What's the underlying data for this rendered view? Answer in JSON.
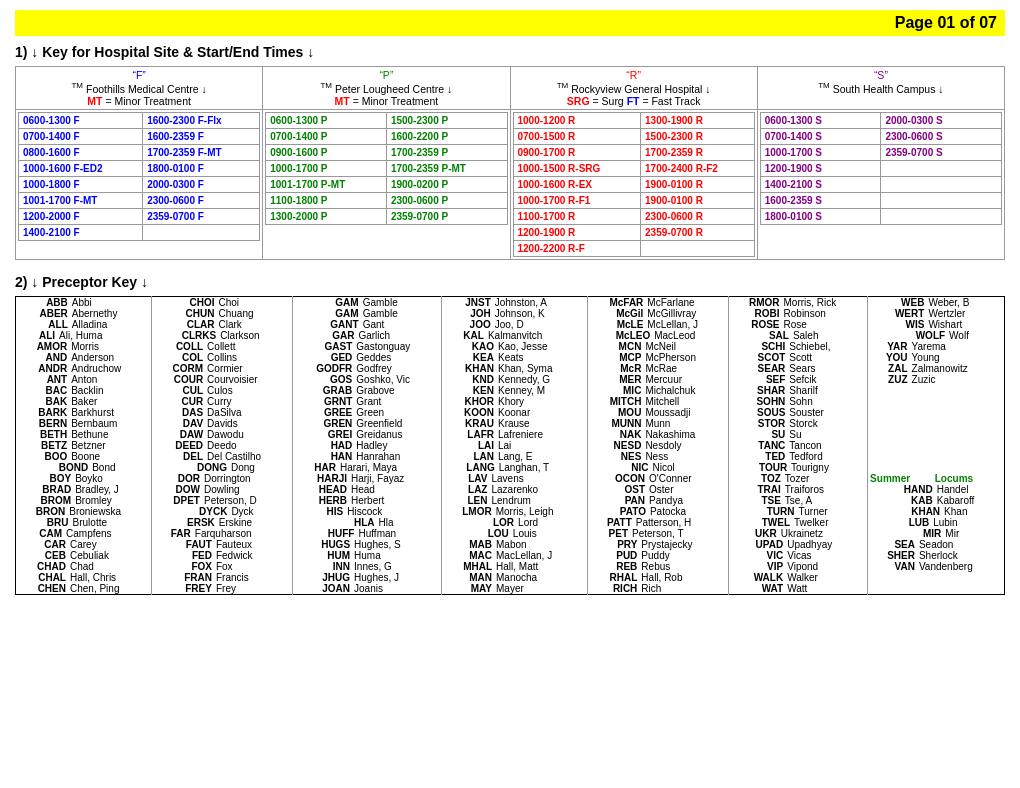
{
  "header": {
    "page": "Page 01 of 07"
  },
  "section1": {
    "title": "1)  ↓ Key for Hospital Site & Start/End Times ↓"
  },
  "hospitals": [
    {
      "label": "\"F\"",
      "color": "blue",
      "name": "Foothills Medical Centre ↓",
      "mt": "MT = Minor Treatment",
      "times": [
        [
          "0600-1300 F",
          "1600-2300 F-Flx"
        ],
        [
          "0700-1400 F",
          "1600-2359 F"
        ],
        [
          "0800-1600 F",
          "1700-2359 F-MT"
        ],
        [
          "1000-1600 F-ED2",
          "1800-0100 F"
        ],
        [
          "1000-1800 F",
          "2000-0300 F"
        ],
        [
          "1001-1700 F-MT",
          "2300-0600 F"
        ],
        [
          "1200-2000 F",
          "2359-0700 F"
        ],
        [
          "1400-2100 F",
          ""
        ]
      ]
    },
    {
      "label": "\"P\"",
      "color": "green",
      "name": "Peter Lougheed Centre ↓",
      "mt": "MT = Minor Treatment",
      "times": [
        [
          "0600-1300 P",
          "1500-2300 P"
        ],
        [
          "0700-1400 P",
          "1600-2200 P"
        ],
        [
          "0900-1600 P",
          "1700-2359 P"
        ],
        [
          "1000-1700 P",
          "1700-2359 P-MT"
        ],
        [
          "1001-1700 P-MT",
          "1900-0200 P"
        ],
        [
          "1100-1800 P",
          "2300-0600 P"
        ],
        [
          "1300-2000 P",
          "2359-0700 P"
        ]
      ]
    },
    {
      "label": "\"R\"",
      "color": "red",
      "name": "Rockyview General Hospital ↓",
      "mt": "SRG = Surg  FT = Fast Track",
      "times": [
        [
          "1000-1200 R",
          "1300-1900 R"
        ],
        [
          "0700-1500 R",
          "1500-2300 R"
        ],
        [
          "0900-1700 R",
          "1700-2359 R"
        ],
        [
          "1000-1500 R-SRG",
          "1700-2400 R-F2"
        ],
        [
          "1000-1600 R-EX",
          "1900-0100 R"
        ],
        [
          "1000-1700 R-F1",
          "1900-0100 R"
        ],
        [
          "1100-1700 R",
          "2300-0600 R"
        ],
        [
          "1200-1900 R",
          "2359-0700 R"
        ],
        [
          "1200-2200 R-F",
          ""
        ]
      ]
    },
    {
      "label": "\"S\"",
      "color": "purple",
      "name": "South Health Campus ↓",
      "times": [
        [
          "0600-1300 S",
          "2000-0300 S"
        ],
        [
          "0700-1400 S",
          "2300-0600 S"
        ],
        [
          "1000-1700 S",
          "2359-0700 S"
        ],
        [
          "1200-1900 S",
          ""
        ],
        [
          "1400-2100 S",
          ""
        ],
        [
          "1600-2359 S",
          ""
        ],
        [
          "1800-0100 S",
          ""
        ]
      ]
    }
  ],
  "section2": {
    "title": "2)  ↓ Preceptor Key ↓"
  },
  "preceptors": [
    {
      "code": "ABB",
      "name": "Abbi"
    },
    {
      "code": "ABER",
      "name": "Abernethy"
    },
    {
      "code": "ALL",
      "name": "Alladina"
    },
    {
      "code": "ALI",
      "name": "Ali, Huma"
    },
    {
      "code": "AMOR",
      "name": "Morris"
    },
    {
      "code": "AND",
      "name": "Anderson"
    },
    {
      "code": "ANDR",
      "name": "Andruchow"
    },
    {
      "code": "ANT",
      "name": "Anton"
    },
    {
      "code": "BAC",
      "name": "Backlin"
    },
    {
      "code": "BAK",
      "name": "Baker"
    },
    {
      "code": "BARK",
      "name": "Barkhurst"
    },
    {
      "code": "BERN",
      "name": "Bernbaum"
    },
    {
      "code": "BETH",
      "name": "Bethune"
    },
    {
      "code": "BETZ",
      "name": "Betzner"
    },
    {
      "code": "BOO",
      "name": "Boone"
    },
    {
      "code": "BOND",
      "name": "Bond"
    },
    {
      "code": "BOY",
      "name": "Boyko"
    },
    {
      "code": "BRAD",
      "name": "Bradley, J"
    },
    {
      "code": "BROM",
      "name": "Bromley"
    },
    {
      "code": "BRON",
      "name": "Broniewska"
    },
    {
      "code": "BRU",
      "name": "Brulotte"
    },
    {
      "code": "CAM",
      "name": "Campfens"
    },
    {
      "code": "CAR",
      "name": "Carey"
    },
    {
      "code": "CEB",
      "name": "Cebuliak"
    },
    {
      "code": "CHAD",
      "name": "Chad"
    },
    {
      "code": "CHAL",
      "name": "Hall, Chris"
    },
    {
      "code": "CHEN",
      "name": "Chen, Ping"
    },
    {
      "code": "CHOI",
      "name": "Choi"
    },
    {
      "code": "CHUN",
      "name": "Chuang"
    },
    {
      "code": "CLAR",
      "name": "Clark"
    },
    {
      "code": "CLRKS",
      "name": "Clarkson"
    },
    {
      "code": "COLL",
      "name": "Collett"
    },
    {
      "code": "COL",
      "name": "Collins"
    },
    {
      "code": "CORM",
      "name": "Cormier"
    },
    {
      "code": "COUR",
      "name": "Courvoisier"
    },
    {
      "code": "CUL",
      "name": "Culos"
    },
    {
      "code": "CUR",
      "name": "Curry"
    },
    {
      "code": "DAS",
      "name": "DaSilva"
    },
    {
      "code": "DAV",
      "name": "Davids"
    },
    {
      "code": "DAW",
      "name": "Dawodu"
    },
    {
      "code": "DEED",
      "name": "Deedo"
    },
    {
      "code": "DEL",
      "name": "Del Castilho"
    },
    {
      "code": "DONG",
      "name": "Dong"
    },
    {
      "code": "DOR",
      "name": "Dorrington"
    },
    {
      "code": "DOW",
      "name": "Dowling"
    },
    {
      "code": "DPET",
      "name": "Peterson, D"
    },
    {
      "code": "DYCK",
      "name": "Dyck"
    },
    {
      "code": "ERSK",
      "name": "Erskine"
    },
    {
      "code": "FAR",
      "name": "Farquharson"
    },
    {
      "code": "FAUT",
      "name": "Fauteux"
    },
    {
      "code": "FED",
      "name": "Fedwick"
    },
    {
      "code": "FOX",
      "name": "Fox"
    },
    {
      "code": "FRAN",
      "name": "Francis"
    },
    {
      "code": "FREY",
      "name": "Frey"
    },
    {
      "code": "GAM",
      "name": "Gamble"
    },
    {
      "code": "GAM",
      "name": "Gamble"
    },
    {
      "code": "GANT",
      "name": "Gant"
    },
    {
      "code": "GAR",
      "name": "Garlich"
    },
    {
      "code": "GAST",
      "name": "Gastonguay"
    },
    {
      "code": "GED",
      "name": "Geddes"
    },
    {
      "code": "GODFR",
      "name": "Godfrey"
    },
    {
      "code": "GOS",
      "name": "Goshko, Vic"
    },
    {
      "code": "GRAB",
      "name": "Grabove"
    },
    {
      "code": "GRNT",
      "name": "Grant"
    },
    {
      "code": "GREE",
      "name": "Green"
    },
    {
      "code": "GREN",
      "name": "Greenfield"
    },
    {
      "code": "GREI",
      "name": "Greidanus"
    },
    {
      "code": "HAD",
      "name": "Hadley"
    },
    {
      "code": "HAN",
      "name": "Hanrahan"
    },
    {
      "code": "HAR",
      "name": "Harari, Maya"
    },
    {
      "code": "HARJI",
      "name": "Harji, Fayaz"
    },
    {
      "code": "HEAD",
      "name": "Head"
    },
    {
      "code": "HERB",
      "name": "Herbert"
    },
    {
      "code": "HIS",
      "name": "Hiscock"
    },
    {
      "code": "HLA",
      "name": "Hla"
    },
    {
      "code": "HUFF",
      "name": "Huffman"
    },
    {
      "code": "HUGS",
      "name": "Hughes, S"
    },
    {
      "code": "HUM",
      "name": "Huma"
    },
    {
      "code": "INN",
      "name": "Innes, G"
    },
    {
      "code": "JHUG",
      "name": "Hughes, J"
    },
    {
      "code": "JOAN",
      "name": "Joanis"
    },
    {
      "code": "JNST",
      "name": "Johnston, A"
    },
    {
      "code": "JOH",
      "name": "Johnson, K"
    },
    {
      "code": "JOO",
      "name": "Joo, D"
    },
    {
      "code": "KAL",
      "name": "Kalmanvitch"
    },
    {
      "code": "KAO",
      "name": "Kao, Jesse"
    },
    {
      "code": "KEA",
      "name": "Keats"
    },
    {
      "code": "KHAN",
      "name": "Khan, Syma"
    },
    {
      "code": "KND",
      "name": "Kennedy, G"
    },
    {
      "code": "KEN",
      "name": "Kenney, M"
    },
    {
      "code": "KHOR",
      "name": "Khory"
    },
    {
      "code": "KOON",
      "name": "Koonar"
    },
    {
      "code": "KRAU",
      "name": "Krause"
    },
    {
      "code": "LAFR",
      "name": "Lafreniere"
    },
    {
      "code": "LAI",
      "name": "Lai"
    },
    {
      "code": "LAN",
      "name": "Lang, E"
    },
    {
      "code": "LANG",
      "name": "Langhan, T"
    },
    {
      "code": "LAV",
      "name": "Lavens"
    },
    {
      "code": "LAZ",
      "name": "Lazarenko"
    },
    {
      "code": "LEN",
      "name": "Lendrum"
    },
    {
      "code": "LMOR",
      "name": "Morris, Leigh"
    },
    {
      "code": "LOR",
      "name": "Lord"
    },
    {
      "code": "LOU",
      "name": "Louis"
    },
    {
      "code": "MAB",
      "name": "Mabon"
    },
    {
      "code": "MAC",
      "name": "MacLellan, J"
    },
    {
      "code": "MHAL",
      "name": "Hall, Matt"
    },
    {
      "code": "MAN",
      "name": "Manocha"
    },
    {
      "code": "MAY",
      "name": "Mayer"
    },
    {
      "code": "McFAR",
      "name": "McFarlane"
    },
    {
      "code": "McGil",
      "name": "McGillivray"
    },
    {
      "code": "McLE",
      "name": "McLellan, J"
    },
    {
      "code": "McLEO",
      "name": "MacLeod"
    },
    {
      "code": "MCN",
      "name": "McNeil"
    },
    {
      "code": "MCP",
      "name": "McPherson"
    },
    {
      "code": "McR",
      "name": "McRae"
    },
    {
      "code": "MER",
      "name": "Mercuur"
    },
    {
      "code": "MIC",
      "name": "Michalchuk"
    },
    {
      "code": "MITCH",
      "name": "Mitchell"
    },
    {
      "code": "MOU",
      "name": "Moussadji"
    },
    {
      "code": "MUNN",
      "name": "Munn"
    },
    {
      "code": "NAK",
      "name": "Nakashima"
    },
    {
      "code": "NESD",
      "name": "Nesdoly"
    },
    {
      "code": "NES",
      "name": "Ness"
    },
    {
      "code": "NIC",
      "name": "Nicol"
    },
    {
      "code": "OCON",
      "name": "O'Conner"
    },
    {
      "code": "OST",
      "name": "Oster"
    },
    {
      "code": "PAN",
      "name": "Pandya"
    },
    {
      "code": "PATO",
      "name": "Patocka"
    },
    {
      "code": "PATT",
      "name": "Patterson, H"
    },
    {
      "code": "PET",
      "name": "Peterson, T"
    },
    {
      "code": "PRY",
      "name": "Prystajecky"
    },
    {
      "code": "PUD",
      "name": "Puddy"
    },
    {
      "code": "REB",
      "name": "Rebus"
    },
    {
      "code": "RHAL",
      "name": "Hall, Rob"
    },
    {
      "code": "RICH",
      "name": "Rich"
    },
    {
      "code": "RMOR",
      "name": "Morris, Rick"
    },
    {
      "code": "ROBI",
      "name": "Robinson"
    },
    {
      "code": "ROSE",
      "name": "Rose"
    },
    {
      "code": "SAL",
      "name": "Saleh"
    },
    {
      "code": "SCHI",
      "name": "Schiebel,"
    },
    {
      "code": "SCOT",
      "name": "Scott"
    },
    {
      "code": "SEAR",
      "name": "Sears"
    },
    {
      "code": "SEF",
      "name": "Sefcik"
    },
    {
      "code": "SHAR",
      "name": "Sharilf"
    },
    {
      "code": "SOHN",
      "name": "Sohn"
    },
    {
      "code": "SOUS",
      "name": "Souster"
    },
    {
      "code": "STOR",
      "name": "Storck"
    },
    {
      "code": "SU",
      "name": "Su"
    },
    {
      "code": "TANC",
      "name": "Tancon"
    },
    {
      "code": "TED",
      "name": "Tedford"
    },
    {
      "code": "TOUR",
      "name": "Tourigny"
    },
    {
      "code": "TOZ",
      "name": "Tozer"
    },
    {
      "code": "TRAI",
      "name": "Traiforos"
    },
    {
      "code": "TSE",
      "name": "Tse, A"
    },
    {
      "code": "TURN",
      "name": "Turner"
    },
    {
      "code": "TWEL",
      "name": "Twelker"
    },
    {
      "code": "UKR",
      "name": "Ukrainetz"
    },
    {
      "code": "UPAD",
      "name": "Upadhyay"
    },
    {
      "code": "VIC",
      "name": "Vicas"
    },
    {
      "code": "VIP",
      "name": "Vipond"
    },
    {
      "code": "WALK",
      "name": "Walker"
    },
    {
      "code": "WAT",
      "name": "Watt"
    },
    {
      "code": "WEB",
      "name": "Weber, B"
    },
    {
      "code": "WERT",
      "name": "Wertzler"
    },
    {
      "code": "WIS",
      "name": "Wishart"
    },
    {
      "code": "WOLF",
      "name": "Wolf"
    },
    {
      "code": "YAR",
      "name": "Yarema"
    },
    {
      "code": "YOU",
      "name": "Young"
    },
    {
      "code": "ZAL",
      "name": "Zalmanowitz"
    },
    {
      "code": "ZUZ",
      "name": "Zuzic"
    },
    {
      "code": "Summer",
      "name": "Locums",
      "special": true
    },
    {
      "code": "HAND",
      "name": "Handel"
    },
    {
      "code": "KAB",
      "name": "Kabaroff"
    },
    {
      "code": "KHAN",
      "name": "Khan"
    },
    {
      "code": "LUB",
      "name": "Lubin"
    },
    {
      "code": "MIR",
      "name": "Mir"
    },
    {
      "code": "SEA",
      "name": "Seadon"
    },
    {
      "code": "SHER",
      "name": "Sherlock"
    },
    {
      "code": "VAN",
      "name": "Vandenberg"
    }
  ]
}
